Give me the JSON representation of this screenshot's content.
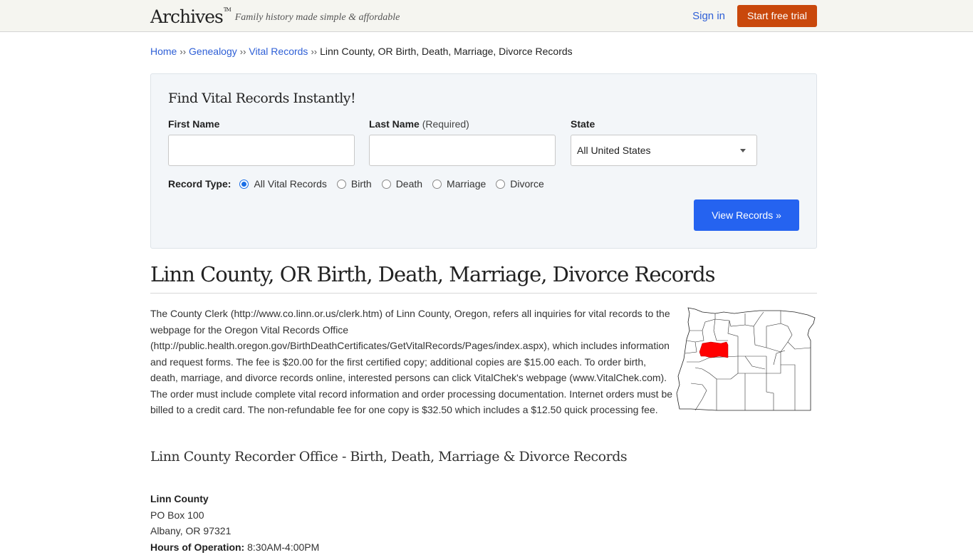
{
  "header": {
    "logo": "Archives",
    "logo_tm": "TM",
    "tagline": "Family history made simple & affordable",
    "signin_label": "Sign in",
    "trial_label": "Start free trial"
  },
  "breadcrumb": {
    "items": [
      "Home",
      "Genealogy",
      "Vital Records"
    ],
    "separator": "››",
    "current": "Linn County, OR Birth, Death, Marriage, Divorce Records"
  },
  "search": {
    "title": "Find Vital Records Instantly!",
    "first_name_label": "First Name",
    "first_name_value": "",
    "last_name_label": "Last Name",
    "last_name_required": "(Required)",
    "last_name_value": "",
    "state_label": "State",
    "state_selected": "All United States",
    "record_type_label": "Record Type:",
    "record_types": [
      "All Vital Records",
      "Birth",
      "Death",
      "Marriage",
      "Divorce"
    ],
    "record_type_selected": "All Vital Records",
    "submit_label": "View Records »"
  },
  "main": {
    "title": "Linn County, OR Birth, Death, Marriage, Divorce Records",
    "description": "The County Clerk (http://www.co.linn.or.us/clerk.htm) of Linn County, Oregon, refers all inquiries for vital records to the webpage for the Oregon Vital Records Office (http://public.health.oregon.gov/BirthDeathCertificates/GetVitalRecords/Pages/index.aspx), which includes information and request forms. The fee is $20.00 for the first certified copy; additional copies are $15.00 each. To order birth, death, marriage, and divorce records online, interested persons can click VitalChek's webpage (www.VitalChek.com). The order must include complete vital record information and order processing documentation. Internet orders must be billed to a credit card. The non-refundable fee for one copy is $32.50 which includes a $12.50 quick processing fee.",
    "map_highlight_color": "#ff0000",
    "section_title": "Linn County Recorder Office - Birth, Death, Marriage & Divorce Records"
  },
  "office": {
    "name": "Linn County",
    "address1": "PO Box 100",
    "address2": "Albany, OR 97321",
    "hours_label": "Hours of Operation:",
    "hours_value": "8:30AM-4:00PM"
  }
}
